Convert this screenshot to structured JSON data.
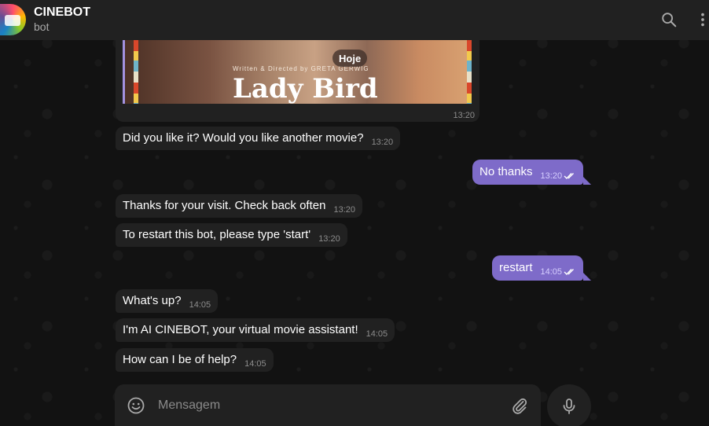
{
  "header": {
    "title": "CINEBOT",
    "subtitle": "bot"
  },
  "image_message": {
    "poster_credit": "Written & Directed by GRETA GERWIG",
    "poster_title": "Lady Bird",
    "date_label": "Hoje",
    "time": "13:20"
  },
  "messages": [
    {
      "dir": "in",
      "text": "Did you like it? Would you like another movie?",
      "time": "13:20"
    },
    {
      "dir": "out",
      "text": "No thanks",
      "time": "13:20"
    },
    {
      "dir": "in",
      "text": "Thanks for your visit. Check back often",
      "time": "13:20"
    },
    {
      "dir": "in",
      "text": "To restart this bot, please type 'start'",
      "time": "13:20"
    },
    {
      "dir": "out",
      "text": "restart",
      "time": "14:05"
    },
    {
      "dir": "in",
      "text": "What's up?",
      "time": "14:05"
    },
    {
      "dir": "in",
      "text": "I'm AI CINEBOT, your virtual movie assistant!",
      "time": "14:05"
    },
    {
      "dir": "in",
      "text": "How can I be of help?",
      "time": "14:05"
    }
  ],
  "composer": {
    "placeholder": "Mensagem"
  },
  "icons": {
    "search": "search-icon",
    "more": "more-vertical-icon",
    "emoji": "smile-icon",
    "attach": "paperclip-icon",
    "mic": "microphone-icon",
    "read": "double-check-icon"
  },
  "colors": {
    "outgoing_bubble": "#7e6bc9",
    "incoming_bubble": "#212121",
    "header": "#212121"
  }
}
